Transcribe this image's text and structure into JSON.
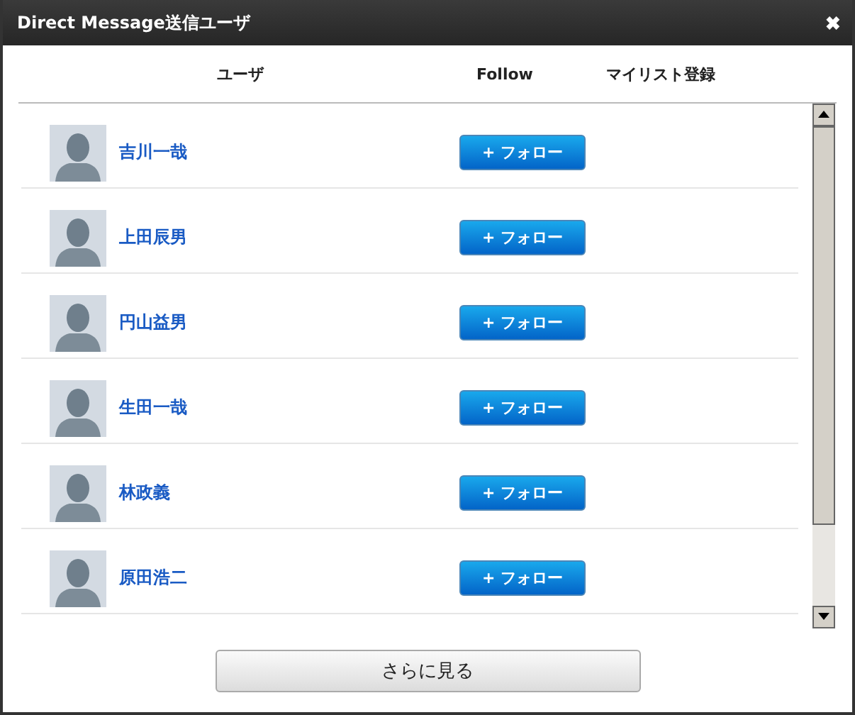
{
  "window": {
    "title": "Direct Message送信ユーザ",
    "close": "✖"
  },
  "columns": [
    "ユーザ",
    "Follow",
    "マイリスト登録"
  ],
  "users": [
    {
      "name": "吉川一哉",
      "button": "+ フォロー"
    },
    {
      "name": "上田辰男",
      "button": "+ フォロー"
    },
    {
      "name": "円山益男",
      "button": "+ フォロー"
    },
    {
      "name": "生田一哉",
      "button": "+ フォロー"
    },
    {
      "name": "林政義",
      "button": "+ フォロー"
    },
    {
      "name": "原田浩二",
      "button": "+ フォロー"
    }
  ],
  "more_button": "さらに見る"
}
